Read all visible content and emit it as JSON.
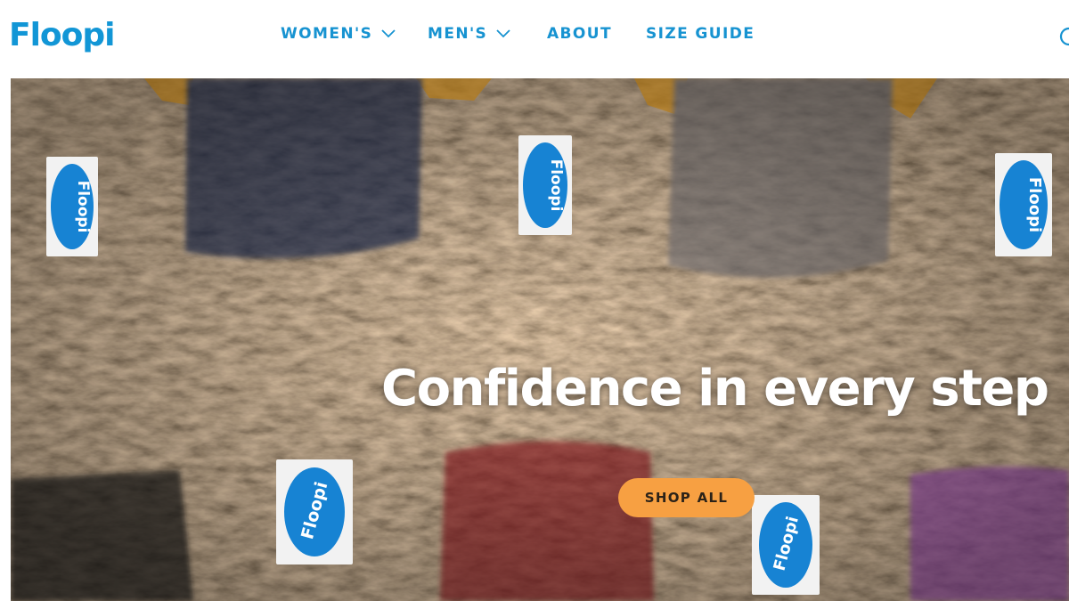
{
  "brand": {
    "logo_text": "Floopi",
    "color": "#1296d6"
  },
  "nav": {
    "items": [
      {
        "label": "WOMEN'S",
        "has_dropdown": true
      },
      {
        "label": "MEN'S",
        "has_dropdown": true
      },
      {
        "label": "ABOUT",
        "has_dropdown": false
      },
      {
        "label": "SIZE GUIDE",
        "has_dropdown": false
      }
    ],
    "color": "#1793d1"
  },
  "hero": {
    "headline": "Confidence in every step",
    "cta_label": "SHOP ALL",
    "cta_color": "#f7a042",
    "tag_text": "Floopi",
    "image": "faux-fur-slippers-assorted-colors"
  }
}
